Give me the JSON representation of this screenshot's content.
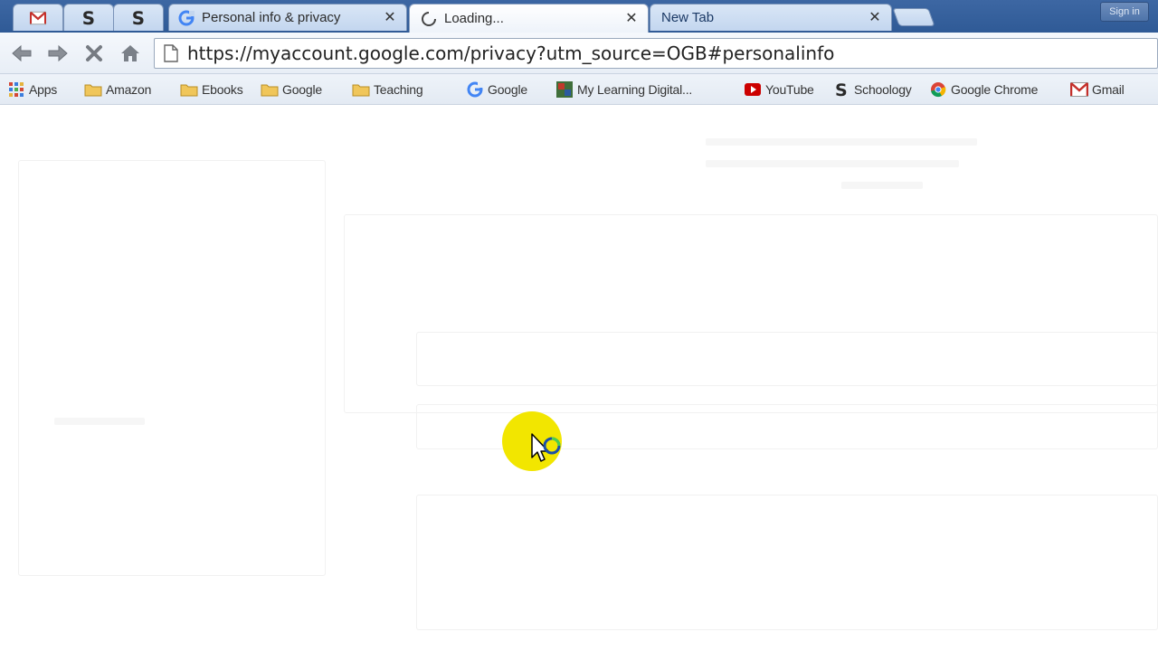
{
  "browser": {
    "tabs": [
      {
        "title": "",
        "favicon": "gmail-icon",
        "pinned": true
      },
      {
        "title": "",
        "favicon": "s-logo-icon",
        "pinned": true
      },
      {
        "title": "",
        "favicon": "s-logo-icon",
        "pinned": true
      },
      {
        "title": "Personal info & privacy",
        "favicon": "google-icon",
        "pinned": false,
        "close": "✕"
      },
      {
        "title": "Loading...",
        "favicon": "loading-spinner-icon",
        "pinned": false,
        "active": true,
        "close": "✕"
      },
      {
        "title": "New Tab",
        "favicon": "",
        "pinned": false,
        "close": "✕"
      }
    ],
    "signin_label": "Sign in",
    "toolbar": {
      "back": "back-arrow-icon",
      "forward": "forward-arrow-icon",
      "stop": "stop-icon",
      "home": "home-icon"
    },
    "omnibox": {
      "url": "https://myaccount.google.com/privacy?utm_source=OGB#personalinfo"
    },
    "bookmarks": [
      {
        "label": "Apps",
        "icon": "apps-grid-icon"
      },
      {
        "label": "Amazon",
        "icon": "folder-icon"
      },
      {
        "label": "Ebooks",
        "icon": "folder-icon"
      },
      {
        "label": "Google",
        "icon": "folder-icon"
      },
      {
        "label": "Teaching",
        "icon": "folder-icon"
      },
      {
        "label": "Google",
        "icon": "google-icon"
      },
      {
        "label": "My Learning Digital...",
        "icon": "site-icon"
      },
      {
        "label": "YouTube",
        "icon": "youtube-icon"
      },
      {
        "label": "Schoology",
        "icon": "s-logo-icon"
      },
      {
        "label": "Google Chrome",
        "icon": "chrome-icon"
      },
      {
        "label": "Gmail",
        "icon": "gmail-icon"
      }
    ]
  },
  "colors": {
    "tabstrip": "#2f5a96",
    "cursor_highlight": "#f2e600"
  }
}
